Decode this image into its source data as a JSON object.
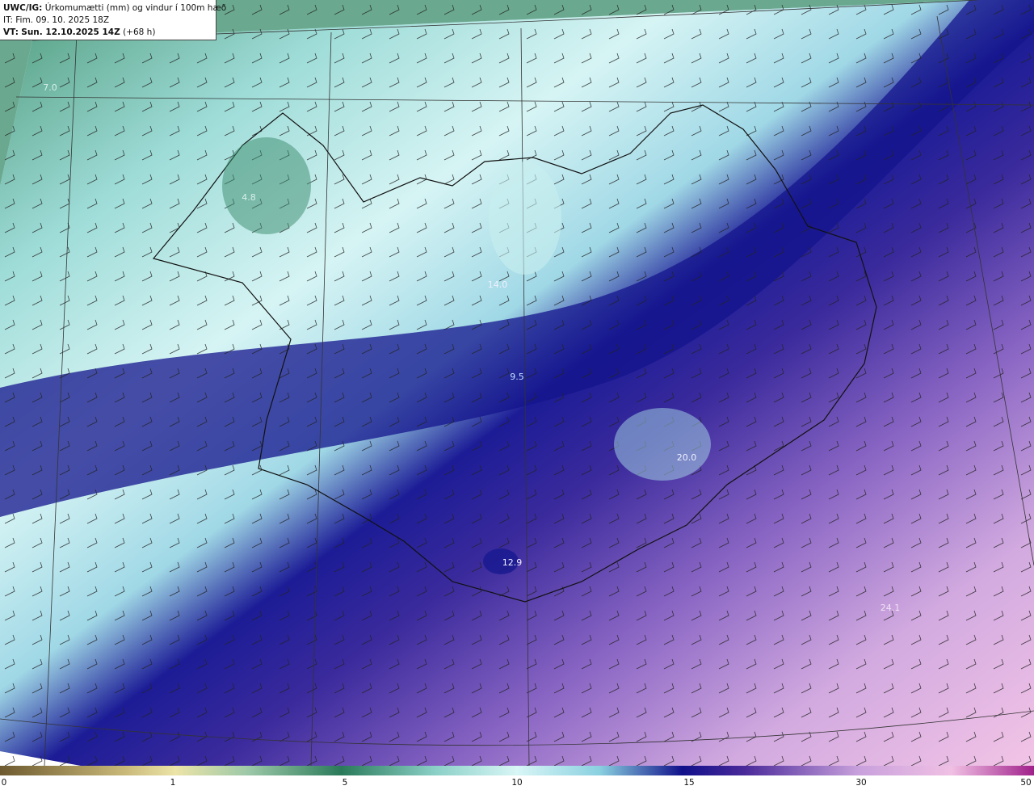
{
  "header": {
    "product_label": "UWC/IG:",
    "product_desc": "Úrkomumætti (mm) og vindur í 100m hæð",
    "it_label": "IT:",
    "it_value": "Fim. 09. 10. 2025 18Z",
    "vt_label": "VT:",
    "vt_value": "Sun. 12.10.2025 14Z",
    "vt_offset": "(+68 h)"
  },
  "colorbar": {
    "ticks": [
      "0",
      "1",
      "5",
      "10",
      "15",
      "30",
      "50"
    ],
    "colors": [
      "#7a6a3a",
      "#c8b878",
      "#e8e0a0",
      "#7fb89a",
      "#2a7a5a",
      "#c8f0f0",
      "#8ad0e0",
      "#2e3aa0",
      "#10108a",
      "#4a2a9a",
      "#8a62c0",
      "#c8a0dc",
      "#f0c0e4",
      "#b0309a"
    ]
  },
  "map_labels": [
    {
      "text": "7.0"
    },
    {
      "text": "4.8"
    },
    {
      "text": "14.0"
    },
    {
      "text": "12.9"
    },
    {
      "text": "24.1"
    },
    {
      "text": "20.0"
    },
    {
      "text": "9.5"
    }
  ],
  "colors": {
    "header_bg": "#ffffff",
    "coast": "#111111"
  }
}
